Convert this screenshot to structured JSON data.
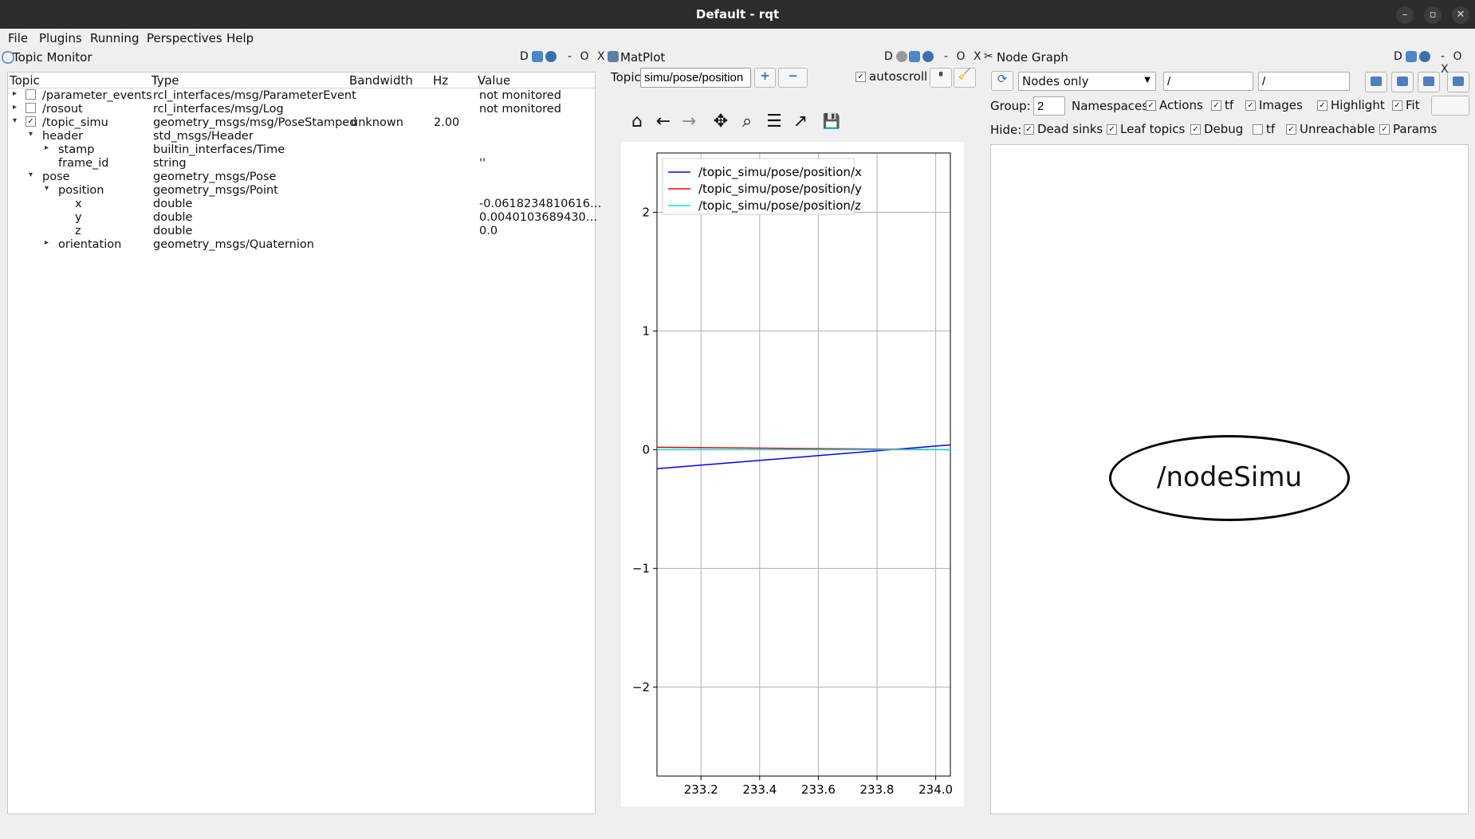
{
  "window": {
    "title": "Default - rqt",
    "controls": {
      "minimize": "–",
      "restore": "▫",
      "close": "✕"
    }
  },
  "menu": [
    "File",
    "Plugins",
    "Running",
    "Perspectives",
    "Help"
  ],
  "topic_monitor": {
    "title": "Topic Monitor",
    "badge": "D",
    "controls": "- O X",
    "columns": [
      "Topic",
      "Type",
      "Bandwidth",
      "Hz",
      "Value"
    ],
    "rows": [
      {
        "arrow": "▸",
        "check": "",
        "name": "/parameter_events",
        "type": "rcl_interfaces/msg/ParameterEvent",
        "bandwidth": "",
        "hz": "",
        "value": "not monitored"
      },
      {
        "arrow": "▸",
        "check": "",
        "name": "/rosout",
        "type": "rcl_interfaces/msg/Log",
        "bandwidth": "",
        "hz": "",
        "value": "not monitored"
      },
      {
        "arrow": "▾",
        "check": "✓",
        "name": "/topic_simu",
        "type": "geometry_msgs/msg/PoseStamped",
        "bandwidth": "unknown",
        "hz": "2.00",
        "value": ""
      },
      {
        "arrow": "▾",
        "check": null,
        "name": "header",
        "type": "std_msgs/Header",
        "bandwidth": "",
        "hz": "",
        "value": ""
      },
      {
        "arrow": "▸",
        "check": null,
        "name": "stamp",
        "type": "builtin_interfaces/Time",
        "bandwidth": "",
        "hz": "",
        "value": ""
      },
      {
        "arrow": "",
        "check": null,
        "name": "frame_id",
        "type": "string",
        "bandwidth": "",
        "hz": "",
        "value": "''"
      },
      {
        "arrow": "▾",
        "check": null,
        "name": "pose",
        "type": "geometry_msgs/Pose",
        "bandwidth": "",
        "hz": "",
        "value": ""
      },
      {
        "arrow": "▾",
        "check": null,
        "name": "position",
        "type": "geometry_msgs/Point",
        "bandwidth": "",
        "hz": "",
        "value": ""
      },
      {
        "arrow": "",
        "check": null,
        "name": "x",
        "type": "double",
        "bandwidth": "",
        "hz": "",
        "value": "-0.0618234810616…"
      },
      {
        "arrow": "",
        "check": null,
        "name": "y",
        "type": "double",
        "bandwidth": "",
        "hz": "",
        "value": "0.0040103689430…"
      },
      {
        "arrow": "",
        "check": null,
        "name": "z",
        "type": "double",
        "bandwidth": "",
        "hz": "",
        "value": "0.0"
      },
      {
        "arrow": "▸",
        "check": null,
        "name": "orientation",
        "type": "geometry_msgs/Quaternion",
        "bandwidth": "",
        "hz": "",
        "value": ""
      }
    ]
  },
  "matplot": {
    "title": "MatPlot",
    "badge": "D",
    "controls": "- O X",
    "topic_label": "Topic",
    "topic_value": "simu/pose/position",
    "add_label": "+",
    "remove_label": "−",
    "autoscroll_label": "autoscroll",
    "autoscroll_check": "✓",
    "pause_label": "⏸",
    "clear_label": "🧹",
    "tools": [
      {
        "name": "home-icon",
        "glyph": "⌂"
      },
      {
        "name": "back-icon",
        "glyph": "←"
      },
      {
        "name": "forward-icon",
        "glyph": "→"
      },
      {
        "name": "pan-icon",
        "glyph": "✥"
      },
      {
        "name": "zoom-icon",
        "glyph": "⌕"
      },
      {
        "name": "configure-icon",
        "glyph": "☰"
      },
      {
        "name": "axes-icon",
        "glyph": "↗"
      },
      {
        "name": "save-icon",
        "glyph": "💾"
      }
    ]
  },
  "node_graph": {
    "title": "Node Graph",
    "badge": "D",
    "controls": "- O X",
    "mode": "Nodes only",
    "filter1": "/",
    "filter2": "/",
    "group_label": "Group:",
    "group_value": "2",
    "options": [
      {
        "label": "Namespaces",
        "check": ""
      },
      {
        "label": "Actions",
        "check": "✓"
      },
      {
        "label": "tf",
        "check": "✓"
      },
      {
        "label": "Images",
        "check": "✓"
      },
      {
        "label": "Highlight",
        "check": "✓"
      },
      {
        "label": "Fit",
        "check": "✓"
      }
    ],
    "hide_label": "Hide:",
    "hide_options": [
      {
        "label": "Dead sinks",
        "check": "✓"
      },
      {
        "label": "Leaf topics",
        "check": "✓"
      },
      {
        "label": "Debug",
        "check": "✓"
      },
      {
        "label": "tf",
        "check": ""
      },
      {
        "label": "Unreachable",
        "check": "✓"
      },
      {
        "label": "Params",
        "check": "✓"
      }
    ],
    "node": "/nodeSimu"
  },
  "chart_data": {
    "type": "line",
    "x": [
      233.05,
      234.05
    ],
    "series": [
      {
        "name": "/topic_simu/pose/position/x",
        "color": "#0000ff",
        "values": [
          -0.16,
          0.04
        ]
      },
      {
        "name": "/topic_simu/pose/position/y",
        "color": "#ff0000",
        "values": [
          0.02,
          0.0
        ]
      },
      {
        "name": "/topic_simu/pose/position/z",
        "color": "#00e5e5",
        "values": [
          0.0,
          0.0
        ]
      }
    ],
    "xlim": [
      233.05,
      234.05
    ],
    "ylim": [
      -2.75,
      2.5
    ],
    "xticks": [
      233.2,
      233.4,
      233.6,
      233.8,
      234.0
    ],
    "xtick_labels": [
      "233.2",
      "233.4",
      "233.6",
      "233.8",
      "234.0"
    ],
    "yticks": [
      2,
      1,
      0,
      -1,
      -2
    ],
    "ytick_labels": [
      "2",
      "1",
      "0",
      "−1",
      "−2"
    ],
    "grid": true,
    "legend": "top-left"
  }
}
